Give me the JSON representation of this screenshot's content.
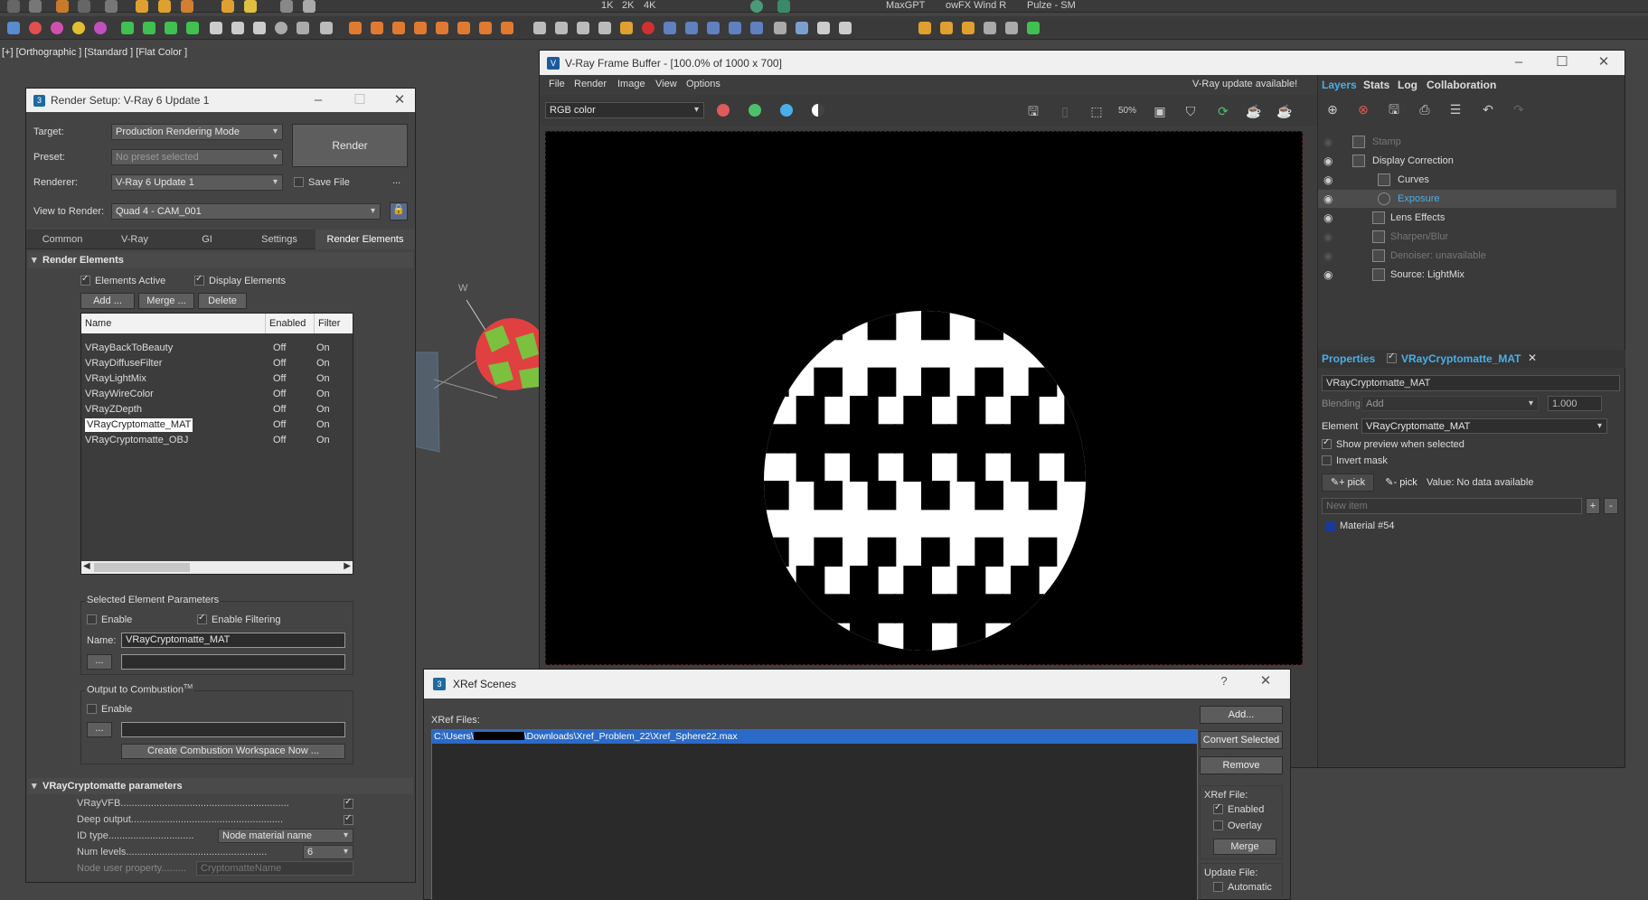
{
  "top_toolbar": {
    "labels": [
      "MaxGPT",
      "owFX Wind R",
      "Pulze - SM"
    ],
    "quality_labels": [
      "1K",
      "2K",
      "4K"
    ]
  },
  "viewport": {
    "label": "[+] [Orthographic ] [Standard ] [Flat Color ]",
    "axis_letter": "W"
  },
  "render_setup": {
    "title": "Render Setup: V-Ray 6 Update 1",
    "target_label": "Target:",
    "target_value": "Production Rendering Mode",
    "preset_label": "Preset:",
    "preset_value": "No preset selected",
    "renderer_label": "Renderer:",
    "renderer_value": "V-Ray 6 Update 1",
    "save_file": "Save File",
    "ellipsis": "...",
    "view_label": "View to Render:",
    "view_value": "Quad 4 - CAM_001",
    "render_btn": "Render",
    "tabs": [
      "Common",
      "V-Ray",
      "GI",
      "Settings",
      "Render Elements"
    ],
    "render_elements": {
      "header": "Render Elements",
      "elements_active": "Elements Active",
      "display_elements": "Display Elements",
      "add_btn": "Add ...",
      "merge_btn": "Merge ...",
      "delete_btn": "Delete",
      "columns": [
        "Name",
        "Enabled",
        "Filter"
      ],
      "rows": [
        {
          "name": "VRayBackToBeauty",
          "enabled": "Off",
          "filter": "On"
        },
        {
          "name": "VRayDiffuseFilter",
          "enabled": "Off",
          "filter": "On"
        },
        {
          "name": "VRayLightMix",
          "enabled": "Off",
          "filter": "On"
        },
        {
          "name": "VRayWireColor",
          "enabled": "Off",
          "filter": "On"
        },
        {
          "name": "VRayZDepth",
          "enabled": "Off",
          "filter": "On"
        },
        {
          "name": "VRayCryptomatte_MAT",
          "enabled": "Off",
          "filter": "On"
        },
        {
          "name": "VRayCryptomatte_OBJ",
          "enabled": "Off",
          "filter": "On"
        }
      ]
    },
    "selected_params": {
      "title": "Selected Element Parameters",
      "enable": "Enable",
      "enable_filtering": "Enable Filtering",
      "name_label": "Name:",
      "name_value": "VRayCryptomatte_MAT",
      "browse": "..."
    },
    "combustion": {
      "title": "Output to Combustion",
      "tm": "TM",
      "enable": "Enable",
      "browse": "...",
      "create_btn": "Create Combustion Workspace Now ..."
    },
    "cryptomatte": {
      "header": "VRayCryptomatte parameters",
      "vrayvfb": "VRayVFB.............................................................",
      "deep_output": "Deep output.......................................................",
      "id_type_label": "ID type...............................",
      "id_type_value": "Node material name",
      "num_levels_label": "Num levels...................................................",
      "num_levels_value": "6",
      "node_user_prop_label": "Node user property.........",
      "node_user_prop_value": "CryptomatteName"
    }
  },
  "vfb": {
    "title": "V-Ray Frame Buffer - [100.0% of 1000 x 700]",
    "menu": [
      "File",
      "Render",
      "Image",
      "View",
      "Options"
    ],
    "update_notice": "V-Ray update available!",
    "channel": "RGB color",
    "zoom_icon": "50%",
    "dot_colors": [
      "#e05a5a",
      "#4fc06a",
      "#4aaee8"
    ],
    "right_tabs": [
      "Layers",
      "Stats",
      "Log",
      "Collaboration"
    ],
    "layers": [
      {
        "label": "Stamp",
        "dim": true
      },
      {
        "label": "Display Correction",
        "dim": false
      },
      {
        "label": "Curves",
        "dim": false
      },
      {
        "label": "Exposure",
        "dim": false
      },
      {
        "label": "Lens Effects",
        "dim": false
      },
      {
        "label": "Sharpen/Blur",
        "dim": true
      },
      {
        "label": "Denoiser: unavailable",
        "dim": true
      },
      {
        "label": "Source: LightMix",
        "dim": false
      }
    ],
    "properties": {
      "title": "Properties",
      "layer_name": "VRayCryptomatte_MAT",
      "name_field": "VRayCryptomatte_MAT",
      "blending_label": "Blending",
      "blending_value": "Add",
      "opacity": "1.000",
      "element_label": "Element",
      "element_value": "VRayCryptomatte_MAT",
      "show_preview": "Show preview when selected",
      "invert_mask": "Invert mask",
      "plus_pick": "+ pick",
      "minus_pick": "- pick",
      "value_text": "Value: No data available",
      "new_item_placeholder": "New item",
      "material": "Material #54",
      "material_color": "#1a3a9a"
    }
  },
  "xref": {
    "title": "XRef Scenes",
    "help": "?",
    "files_label": "XRef Files:",
    "file_path_prefix": "C:\\Users\\",
    "file_path_suffix": "\\Downloads\\Xref_Problem_22\\Xref_Sphere22.max",
    "add_btn": "Add...",
    "convert_btn": "Convert Selected",
    "remove_btn": "Remove",
    "xref_file_label": "XRef File:",
    "enabled": "Enabled",
    "overlay": "Overlay",
    "merge_btn": "Merge",
    "update_file_label": "Update File:",
    "automatic": "Automatic"
  }
}
